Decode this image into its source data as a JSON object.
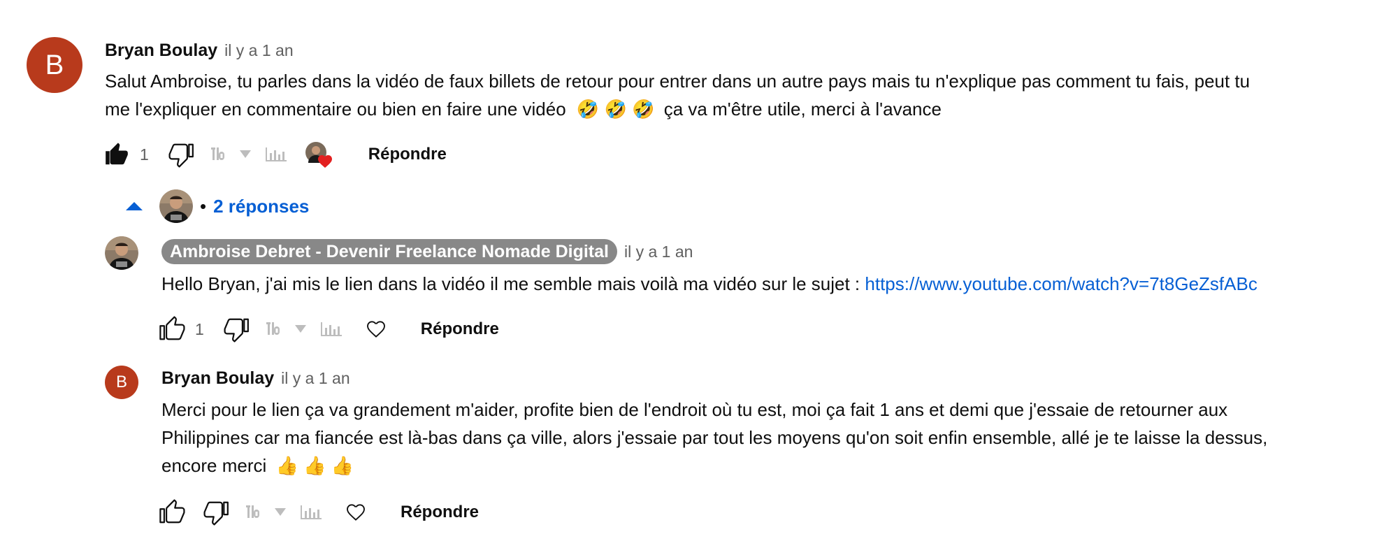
{
  "top_comment": {
    "avatar_letter": "B",
    "author": "Bryan Boulay",
    "time": "il y a 1 an",
    "text_line1": "Salut Ambroise, tu parles dans la vidéo de faux billets de retour pour entrer dans un autre pays mais tu n'explique pas comment tu fais, peut tu",
    "text_line2_pre": "me l'expliquer en commentaire ou bien en faire une vidéo",
    "emoji": "🤣",
    "text_line2_post": "ça va m'être utile, merci à l'avance",
    "like_count": "1",
    "reply_label": "Répondre"
  },
  "replies_toggle": {
    "label": "2 réponses",
    "separator": "•"
  },
  "reply1": {
    "author": "Ambroise Debret - Devenir Freelance Nomade Digital",
    "time": "il y a 1 an",
    "text": "Hello Bryan, j'ai mis le lien dans la vidéo il me semble mais voilà ma vidéo sur le sujet : ",
    "link": "https://www.youtube.com/watch?v=7t8GeZsfABc",
    "like_count": "1",
    "reply_label": "Répondre"
  },
  "reply2": {
    "avatar_letter": "B",
    "author": "Bryan Boulay",
    "time": "il y a 1 an",
    "text_line1": "Merci pour le lien ça va grandement m'aider, profite bien de l'endroit où tu est, moi ça fait 1 ans et demi que j'essaie de retourner aux",
    "text_line2": "Philippines car ma fiancée est là-bas dans ça ville, alors j'essaie par tout les moyens qu'on soit enfin ensemble, allé je te laisse la dessus,",
    "text_line3_pre": "encore merci",
    "emoji": "👍",
    "reply_label": "Répondre"
  },
  "colors": {
    "avatar_bg": "#b83a1c",
    "link": "#065fd4",
    "owner_pill": "#888888",
    "heart": "#e32020"
  }
}
